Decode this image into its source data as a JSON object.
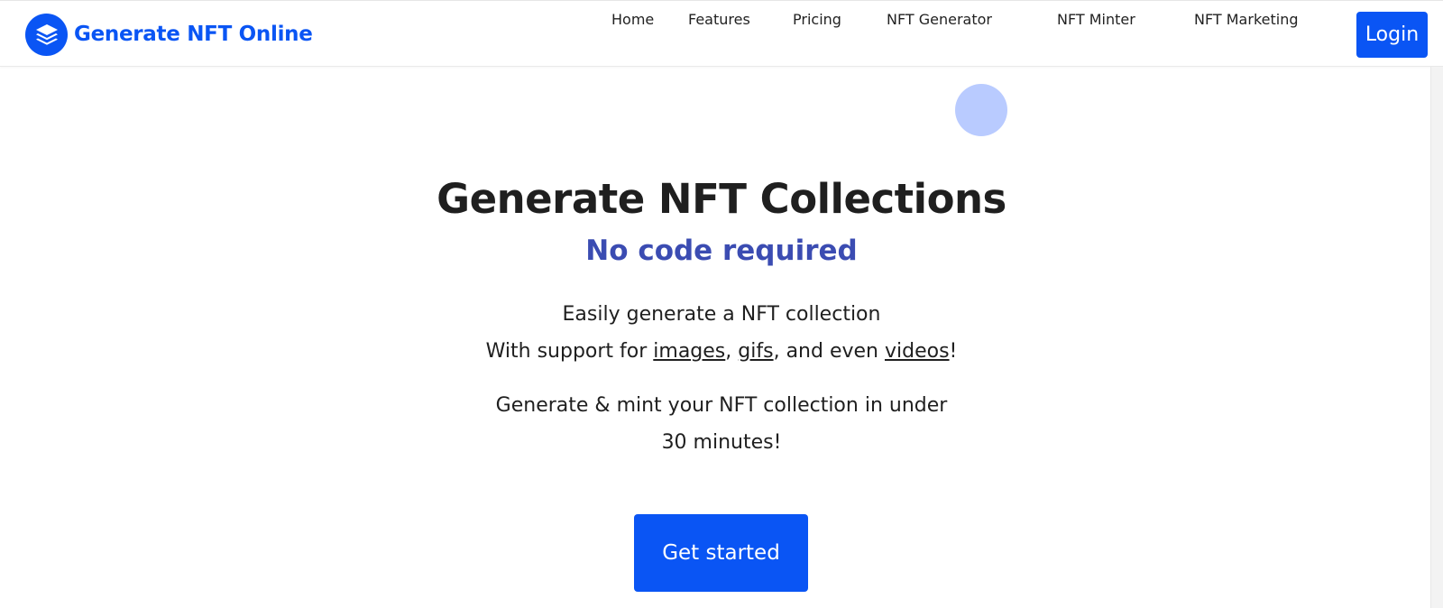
{
  "brand": {
    "name": "Generate NFT Online",
    "logo_icon": "layers-icon",
    "color": "#0a55f4"
  },
  "nav": {
    "items": [
      "Home",
      "Features",
      "Pricing",
      "NFT Generator",
      "NFT Minter",
      "NFT Marketing"
    ],
    "login_label": "Login"
  },
  "hero": {
    "title": "Generate NFT Collections",
    "subtitle": "No code required",
    "subtitle_color": "#3b4cb2",
    "line1": "Easily generate a NFT collection",
    "support_prefix": "With support for ",
    "support_link_images": "images",
    "support_sep1": ", ",
    "support_link_gifs": "gifs",
    "support_sep2": ", and even ",
    "support_link_videos": "videos",
    "support_suffix": "!",
    "mint_line1": "Generate & mint your NFT collection in under",
    "mint_line2": "30 minutes!",
    "cta_label": "Get started"
  }
}
